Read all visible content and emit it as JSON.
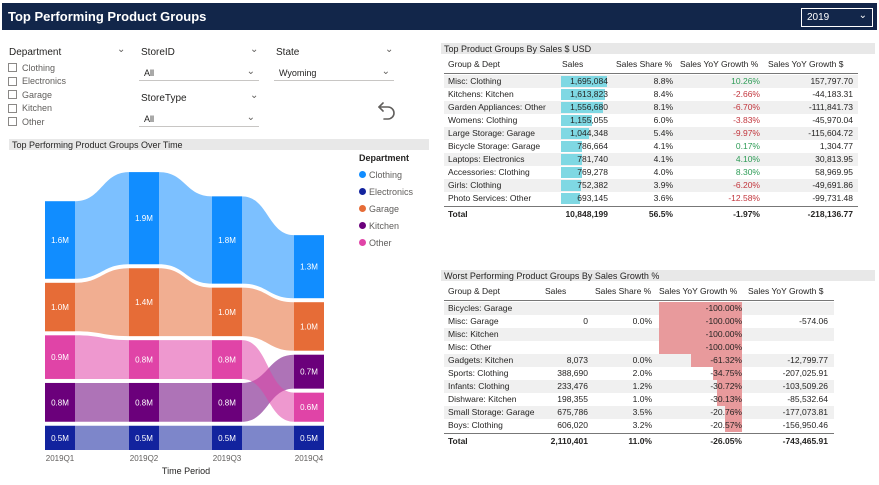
{
  "header": {
    "title": "Top Performing Product Groups",
    "year_value": "2019"
  },
  "slicers": {
    "department": {
      "title": "Department",
      "items": [
        "Clothing",
        "Electronics",
        "Garage",
        "Kitchen",
        "Other"
      ]
    },
    "store_id": {
      "title": "StoreID",
      "value": "All"
    },
    "store_type": {
      "title": "StoreType",
      "value": "All"
    },
    "state": {
      "title": "State",
      "value": "Wyoming"
    }
  },
  "ribbon": {
    "section_title": "Top Performing Product Groups Over Time",
    "xlabel": "Time Period",
    "legend_title": "Department",
    "colors": {
      "Clothing": "#118dff",
      "Electronics": "#12239e",
      "Garage": "#e66c37",
      "Kitchen": "#6b007b",
      "Other": "#e044a7"
    }
  },
  "chart_data": {
    "type": "ribbon",
    "categories": [
      "2019Q1",
      "2019Q2",
      "2019Q3",
      "2019Q4"
    ],
    "xlabel": "Time Period",
    "legend_title": "Department",
    "series": [
      {
        "name": "Clothing",
        "values": [
          1.6,
          1.9,
          1.8,
          1.3
        ],
        "labels": [
          "1.6M",
          "1.9M",
          "1.8M",
          "1.3M"
        ]
      },
      {
        "name": "Electronics",
        "values": [
          0.5,
          0.5,
          0.5,
          0.5
        ],
        "labels": [
          "0.5M",
          "0.5M",
          "0.5M",
          "0.5M"
        ]
      },
      {
        "name": "Garage",
        "values": [
          1.0,
          1.4,
          1.0,
          1.0
        ],
        "labels": [
          "1.0M",
          "1.4M",
          "1.0M",
          "1.0M"
        ]
      },
      {
        "name": "Kitchen",
        "values": [
          0.8,
          0.8,
          0.8,
          0.7
        ],
        "labels": [
          "0.8M",
          "0.8M",
          "0.8M",
          "0.7M"
        ]
      },
      {
        "name": "Other",
        "values": [
          0.9,
          0.8,
          0.8,
          0.6
        ],
        "labels": [
          "0.9M",
          "0.8M",
          "0.8M",
          "0.6M"
        ]
      }
    ],
    "stack_order": [
      [
        "Electronics",
        "Kitchen",
        "Other",
        "Garage",
        "Clothing"
      ],
      [
        "Electronics",
        "Kitchen",
        "Other",
        "Garage",
        "Clothing"
      ],
      [
        "Electronics",
        "Kitchen",
        "Other",
        "Garage",
        "Clothing"
      ],
      [
        "Electronics",
        "Other",
        "Kitchen",
        "Garage",
        "Clothing"
      ]
    ]
  },
  "top_table": {
    "title": "Top Product Groups By Sales $ USD",
    "headers": [
      "Group & Dept",
      "Sales",
      "Sales Share %",
      "Sales YoY Growth %",
      "Sales YoY Growth $"
    ],
    "rows": [
      [
        "Misc: Clothing",
        "1,695,084",
        "8.8%",
        "10.26%",
        "157,797.70"
      ],
      [
        "Kitchens: Kitchen",
        "1,613,823",
        "8.4%",
        "-2.66%",
        "-44,183.31"
      ],
      [
        "Garden Appliances: Other",
        "1,556,680",
        "8.1%",
        "-6.70%",
        "-111,841.73"
      ],
      [
        "Womens: Clothing",
        "1,155,055",
        "6.0%",
        "-3.83%",
        "-45,970.04"
      ],
      [
        "Large Storage: Garage",
        "1,044,348",
        "5.4%",
        "-9.97%",
        "-115,604.72"
      ],
      [
        "Bicycle Storage: Garage",
        "786,664",
        "4.1%",
        "0.17%",
        "1,304.77"
      ],
      [
        "Laptops: Electronics",
        "781,740",
        "4.1%",
        "4.10%",
        "30,813.95"
      ],
      [
        "Accessories: Clothing",
        "769,278",
        "4.0%",
        "8.30%",
        "58,969.95"
      ],
      [
        "Girls: Clothing",
        "752,382",
        "3.9%",
        "-6.20%",
        "-49,691.86"
      ],
      [
        "Photo Services: Other",
        "693,145",
        "3.6%",
        "-12.58%",
        "-99,731.48"
      ]
    ],
    "sales_values": [
      1695084,
      1613823,
      1556680,
      1155055,
      1044348,
      786664,
      781740,
      769278,
      752382,
      693145
    ],
    "total": [
      "Total",
      "10,848,199",
      "56.5%",
      "-1.97%",
      "-218,136.77"
    ]
  },
  "worst_table": {
    "title": "Worst Performing Product Groups By Sales Growth %",
    "headers": [
      "Group & Dept",
      "Sales",
      "Sales Share %",
      "Sales YoY Growth %",
      "Sales YoY Growth $"
    ],
    "rows": [
      [
        "Bicycles: Garage",
        "",
        "",
        "-100.00%",
        ""
      ],
      [
        "Misc: Garage",
        "0",
        "0.0%",
        "-100.00%",
        "-574.06"
      ],
      [
        "Misc: Kitchen",
        "",
        "",
        "-100.00%",
        ""
      ],
      [
        "Misc: Other",
        "",
        "",
        "-100.00%",
        ""
      ],
      [
        "Gadgets: Kitchen",
        "8,073",
        "0.0%",
        "-61.32%",
        "-12,799.77"
      ],
      [
        "Sports: Clothing",
        "388,690",
        "2.0%",
        "-34.75%",
        "-207,025.91"
      ],
      [
        "Infants: Clothing",
        "233,476",
        "1.2%",
        "-30.72%",
        "-103,509.26"
      ],
      [
        "Dishware: Kitchen",
        "198,355",
        "1.0%",
        "-30.13%",
        "-85,532.64"
      ],
      [
        "Small Storage: Garage",
        "675,786",
        "3.5%",
        "-20.76%",
        "-177,073.81"
      ],
      [
        "Boys: Clothing",
        "606,020",
        "3.2%",
        "-20.57%",
        "-156,950.46"
      ]
    ],
    "growth_values": [
      -100.0,
      -100.0,
      -100.0,
      -100.0,
      -61.32,
      -34.75,
      -30.72,
      -30.13,
      -20.76,
      -20.57
    ],
    "total": [
      "Total",
      "2,110,401",
      "11.0%",
      "-26.05%",
      "-743,465.91"
    ]
  }
}
